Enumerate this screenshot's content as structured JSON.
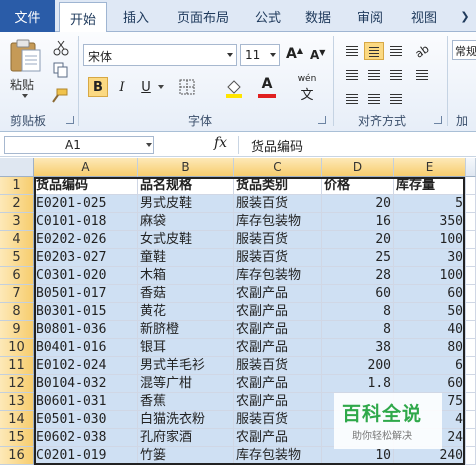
{
  "tabs": {
    "file": "文件",
    "items": [
      "开始",
      "插入",
      "页面布局",
      "公式",
      "数据",
      "审阅",
      "视图"
    ],
    "active_index": 0
  },
  "ribbon": {
    "paste_label": "粘贴",
    "clipboard_label": "剪贴板",
    "font_label": "字体",
    "align_label": "对齐方式",
    "font_name": "宋体",
    "font_size": "11",
    "bold": "B",
    "italic": "I",
    "underline": "U",
    "fill_color": "#ffe500",
    "font_color": "#e02020",
    "wen_label": "wén",
    "wen_char": "文",
    "right_group_top": "常规",
    "right_group_mid": "加"
  },
  "formula_bar": {
    "name_box": "A1",
    "fx": "fx",
    "content": "货品编码"
  },
  "columns": [
    "A",
    "B",
    "C",
    "D",
    "E"
  ],
  "rows": [
    [
      "货品编码",
      "品名规格",
      "货品类别",
      "价格",
      "库存量"
    ],
    [
      "E0201-025",
      "男式皮鞋",
      "服装百货",
      "20",
      "5"
    ],
    [
      "C0101-018",
      "麻袋",
      "库存包装物",
      "16",
      "350"
    ],
    [
      "E0202-026",
      "女式皮鞋",
      "服装百货",
      "20",
      "100"
    ],
    [
      "E0203-027",
      "童鞋",
      "服装百货",
      "25",
      "30"
    ],
    [
      "C0301-020",
      "木箱",
      "库存包装物",
      "28",
      "100"
    ],
    [
      "B0501-017",
      "香菇",
      "农副产品",
      "60",
      "60"
    ],
    [
      "B0301-015",
      "黄花",
      "农副产品",
      "8",
      "50"
    ],
    [
      "B0801-036",
      "新脐橙",
      "农副产品",
      "8",
      "40"
    ],
    [
      "B0401-016",
      "银耳",
      "农副产品",
      "38",
      "80"
    ],
    [
      "E0102-024",
      "男式羊毛衫",
      "服装百货",
      "200",
      "6"
    ],
    [
      "B0104-032",
      "混等广柑",
      "农副产品",
      "1.8",
      "60"
    ],
    [
      "B0601-031",
      "香蕉",
      "农副产品",
      "",
      "75"
    ],
    [
      "E0501-030",
      "白猫洗衣粉",
      "服装百货",
      "",
      "4"
    ],
    [
      "E0602-038",
      "孔府家酒",
      "农副产品",
      "",
      "24"
    ],
    [
      "C0201-019",
      "竹篓",
      "库存包装物",
      "10",
      "240"
    ]
  ],
  "watermark": {
    "title": "百科全说",
    "subtitle": "助你轻松解决"
  }
}
